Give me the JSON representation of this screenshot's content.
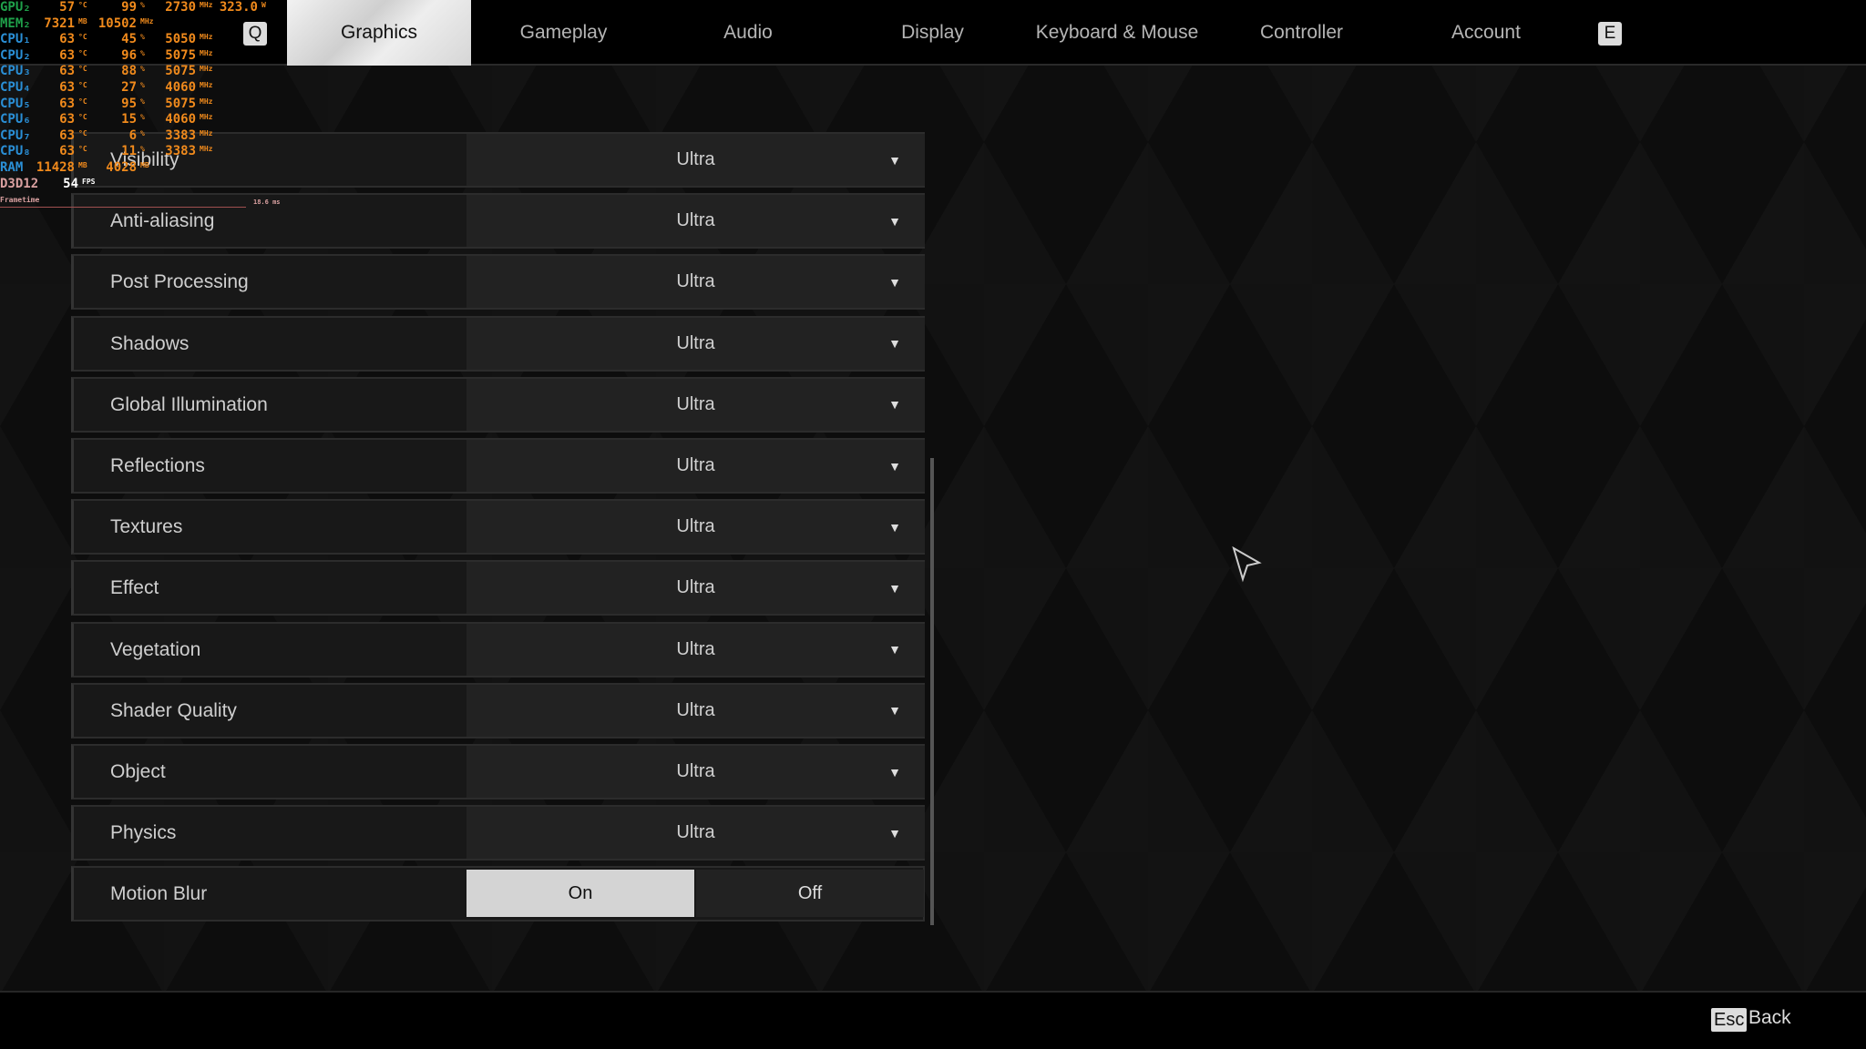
{
  "tabs": [
    {
      "label": "Graphics",
      "active": true
    },
    {
      "label": "Gameplay"
    },
    {
      "label": "Audio"
    },
    {
      "label": "Display"
    },
    {
      "label": "Keyboard & Mouse"
    },
    {
      "label": "Controller"
    },
    {
      "label": "Account"
    }
  ],
  "tab_keys": {
    "prev": "Q",
    "next": "E"
  },
  "settings": [
    {
      "label": "Visibility",
      "value": "Ultra"
    },
    {
      "label": "Anti-aliasing",
      "value": "Ultra"
    },
    {
      "label": "Post Processing",
      "value": "Ultra"
    },
    {
      "label": "Shadows",
      "value": "Ultra"
    },
    {
      "label": "Global Illumination",
      "value": "Ultra"
    },
    {
      "label": "Reflections",
      "value": "Ultra"
    },
    {
      "label": "Textures",
      "value": "Ultra"
    },
    {
      "label": "Effect",
      "value": "Ultra"
    },
    {
      "label": "Vegetation",
      "value": "Ultra"
    },
    {
      "label": "Shader Quality",
      "value": "Ultra"
    },
    {
      "label": "Object",
      "value": "Ultra"
    },
    {
      "label": "Physics",
      "value": "Ultra"
    }
  ],
  "motion_blur": {
    "label": "Motion Blur",
    "on": "On",
    "off": "Off",
    "selected": "On"
  },
  "footer": {
    "key": "Esc",
    "label": "Back"
  },
  "osd": {
    "rows": [
      {
        "name": "GPU₂",
        "color": "#1fa04a",
        "a": "57",
        "au": "°C",
        "b": "99",
        "bu": "%",
        "c": "2730",
        "cu": "MHz",
        "d": "323.0",
        "du": "W"
      },
      {
        "name": "MEM₂",
        "color": "#1fa04a",
        "a": "7321",
        "au": "MB",
        "b": "10502",
        "bu": "MHz"
      },
      {
        "name": "CPU₁",
        "color": "#2a8fd6",
        "a": "63",
        "au": "°C",
        "b": "45",
        "bu": "%",
        "c": "5050",
        "cu": "MHz"
      },
      {
        "name": "CPU₂",
        "color": "#2a8fd6",
        "a": "63",
        "au": "°C",
        "b": "96",
        "bu": "%",
        "c": "5075",
        "cu": "MHz"
      },
      {
        "name": "CPU₃",
        "color": "#2a8fd6",
        "a": "63",
        "au": "°C",
        "b": "88",
        "bu": "%",
        "c": "5075",
        "cu": "MHz"
      },
      {
        "name": "CPU₄",
        "color": "#2a8fd6",
        "a": "63",
        "au": "°C",
        "b": "27",
        "bu": "%",
        "c": "4060",
        "cu": "MHz"
      },
      {
        "name": "CPU₅",
        "color": "#2a8fd6",
        "a": "63",
        "au": "°C",
        "b": "95",
        "bu": "%",
        "c": "5075",
        "cu": "MHz"
      },
      {
        "name": "CPU₆",
        "color": "#2a8fd6",
        "a": "63",
        "au": "°C",
        "b": "15",
        "bu": "%",
        "c": "4060",
        "cu": "MHz"
      },
      {
        "name": "CPU₇",
        "color": "#2a8fd6",
        "a": "63",
        "au": "°C",
        "b": "6",
        "bu": "%",
        "c": "3383",
        "cu": "MHz"
      },
      {
        "name": "CPU₈",
        "color": "#2a8fd6",
        "a": "63",
        "au": "°C",
        "b": "11",
        "bu": "%",
        "c": "3383",
        "cu": "MHz"
      },
      {
        "name": "RAM",
        "color": "#2a8fd6",
        "a": "11428",
        "au": "MB",
        "b": "4028",
        "bu": "MB"
      }
    ],
    "api": "D3D12",
    "fps": "54",
    "fps_unit": "FPS",
    "frametime_label": "Frametime",
    "frametime": "18.6 ms",
    "value_color": "#f08a1c"
  }
}
